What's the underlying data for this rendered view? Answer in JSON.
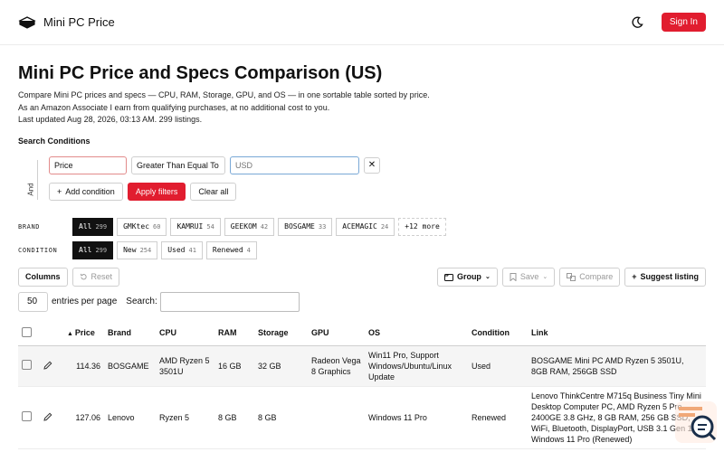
{
  "header": {
    "brand": "Mini PC Price",
    "signin_label": "Sign In"
  },
  "main": {
    "title": "Mini PC Price and Specs Comparison (US)",
    "desc_1": "Compare Mini PC prices and specs — CPU, RAM, Storage, GPU, and OS — in one sortable table sorted by price.",
    "desc_2": "As an Amazon Associate I earn from qualifying purchases, at no additional cost to you.",
    "desc_3": "Last updated Aug 28, 2026, 03:13 AM. 299 listings.",
    "search_conditions_label": "Search Conditions"
  },
  "conditions": {
    "and_label": "And",
    "field": "Price",
    "operator": "Greater Than Equal To",
    "value_placeholder": "USD",
    "remove_label": "✕",
    "add_condition_label": "Add condition",
    "apply_label": "Apply filters",
    "clear_label": "Clear all"
  },
  "brand_filter": {
    "label": "BRAND",
    "chips": [
      {
        "name": "All",
        "count": "299"
      },
      {
        "name": "GMKtec",
        "count": "60"
      },
      {
        "name": "KAMRUI",
        "count": "54"
      },
      {
        "name": "GEEKOM",
        "count": "42"
      },
      {
        "name": "BOSGAME",
        "count": "33"
      },
      {
        "name": "ACEMAGIC",
        "count": "24"
      }
    ],
    "more_label": "+12 more"
  },
  "condition_filter": {
    "label": "CONDITION",
    "chips": [
      {
        "name": "All",
        "count": "299"
      },
      {
        "name": "New",
        "count": "254"
      },
      {
        "name": "Used",
        "count": "41"
      },
      {
        "name": "Renewed",
        "count": "4"
      }
    ]
  },
  "toolbar": {
    "columns_label": "Columns",
    "reset_label": "Reset",
    "group_label": "Group",
    "save_label": "Save",
    "compare_label": "Compare",
    "suggest_label": "Suggest listing"
  },
  "entries": {
    "value": "50",
    "suffix": "entries per page",
    "search_label": "Search:"
  },
  "table": {
    "headers": {
      "price": "Price",
      "brand": "Brand",
      "cpu": "CPU",
      "ram": "RAM",
      "storage": "Storage",
      "gpu": "GPU",
      "os": "OS",
      "condition": "Condition",
      "link": "Link"
    },
    "rows": [
      {
        "price": "114.36",
        "brand": "BOSGAME",
        "cpu": "AMD Ryzen 5 3501U",
        "ram": "16 GB",
        "storage": "32 GB",
        "gpu": "Radeon Vega 8 Graphics",
        "os": "Win11 Pro, Support Windows/Ubuntu/Linux Update",
        "condition": "Used",
        "link": "BOSGAME Mini PC AMD Ryzen 5 3501U, 8GB RAM, 256GB SSD"
      },
      {
        "price": "127.06",
        "brand": "Lenovo",
        "cpu": "Ryzen 5",
        "ram": "8 GB",
        "storage": "8 GB",
        "gpu": "",
        "os": "Windows 11 Pro",
        "condition": "Renewed",
        "link": "Lenovo ThinkCentre M715q Business Tiny Mini Desktop Computer PC, AMD Ryzen 5 Pro 2400GE 3.8 GHz, 8 GB RAM, 256 GB SSD, WiFi, Bluetooth, DisplayPort, USB 3.1 Gen 1, Windows 11 Pro (Renewed)"
      }
    ]
  }
}
